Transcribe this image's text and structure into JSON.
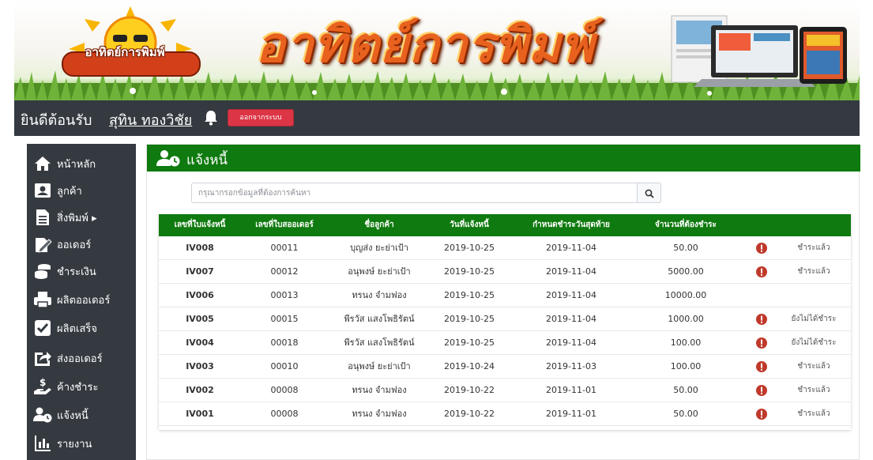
{
  "banner": {
    "logo_text": "อาทิตย์การพิมพ์",
    "title": "อาทิตย์การพิมพ์"
  },
  "topbar": {
    "welcome": "ยินดีต้อนรับ",
    "username": "สุทิน ทองวิชัย",
    "logout_label": "ออกจากระบบ"
  },
  "sidebar": {
    "items": [
      {
        "label": "หน้าหลัก",
        "icon": "home-icon"
      },
      {
        "label": "ลูกค้า",
        "icon": "user-card-icon"
      },
      {
        "label": "สิ่งพิมพ์ ▸",
        "icon": "document-icon"
      },
      {
        "label": "ออเดอร์",
        "icon": "order-edit-icon"
      },
      {
        "label": "ชำระเงิน",
        "icon": "coins-icon"
      },
      {
        "label": "ผลิตออเดอร์",
        "icon": "printer-icon"
      },
      {
        "label": "ผลิตเสร็จ",
        "icon": "checkbox-icon"
      },
      {
        "label": "ส่งออเดอร์",
        "icon": "share-icon"
      },
      {
        "label": "ค้างชำระ",
        "icon": "hand-money-icon"
      },
      {
        "label": "แจ้งหนี้",
        "icon": "user-clock-icon"
      },
      {
        "label": "รายงาน",
        "icon": "chart-icon"
      }
    ]
  },
  "main": {
    "title": "แจ้งหนี้",
    "search_placeholder": "กรุณากรอกข้อมูลที่ต้องการค้นหา",
    "columns": [
      "เลขที่ใบแจ้งหนี้",
      "เลขที่ใบสออเดอร์",
      "ชื่อลูกค้า",
      "วันที่แจ้งหนี้",
      "กำหนดชำระวันสุดท้าย",
      "จำนวนที่ต้องชำระ"
    ],
    "rows": [
      {
        "invoice": "IV008",
        "order": "00011",
        "customer": "บุญส่ง ยะย่าเป้า",
        "date": "2019-10-25",
        "due": "2019-11-04",
        "amount": "50.00",
        "has_icon": true,
        "status": "ชำระแล้ว"
      },
      {
        "invoice": "IV007",
        "order": "00012",
        "customer": "อนุพงษ์ ยะย่าเป้า",
        "date": "2019-10-25",
        "due": "2019-11-04",
        "amount": "5000.00",
        "has_icon": true,
        "status": "ชำระแล้ว"
      },
      {
        "invoice": "IV006",
        "order": "00013",
        "customer": "ทรนง จำมฟอง",
        "date": "2019-10-25",
        "due": "2019-11-04",
        "amount": "10000.00",
        "has_icon": false,
        "status": ""
      },
      {
        "invoice": "IV005",
        "order": "00015",
        "customer": "พีรวัส แสงโพธิรัตน์",
        "date": "2019-10-25",
        "due": "2019-11-04",
        "amount": "1000.00",
        "has_icon": true,
        "status": "ยังไม่ได้ชำระ"
      },
      {
        "invoice": "IV004",
        "order": "00018",
        "customer": "พีรวัส แสงโพธิรัตน์",
        "date": "2019-10-25",
        "due": "2019-11-04",
        "amount": "100.00",
        "has_icon": true,
        "status": "ยังไม่ได้ชำระ"
      },
      {
        "invoice": "IV003",
        "order": "00010",
        "customer": "อนุพงษ์ ยะย่าเป้า",
        "date": "2019-10-24",
        "due": "2019-11-03",
        "amount": "100.00",
        "has_icon": true,
        "status": "ชำระแล้ว"
      },
      {
        "invoice": "IV002",
        "order": "00008",
        "customer": "ทรนง จำมฟอง",
        "date": "2019-10-22",
        "due": "2019-11-01",
        "amount": "50.00",
        "has_icon": true,
        "status": "ชำระแล้ว"
      },
      {
        "invoice": "IV001",
        "order": "00008",
        "customer": "ทรนง จำมฟอง",
        "date": "2019-10-22",
        "due": "2019-11-01",
        "amount": "50.00",
        "has_icon": true,
        "status": "ชำระแล้ว"
      }
    ]
  },
  "colors": {
    "green": "#0f7a0f",
    "dark": "#343a40",
    "danger": "#dc3545",
    "info_red": "#c0392b"
  }
}
